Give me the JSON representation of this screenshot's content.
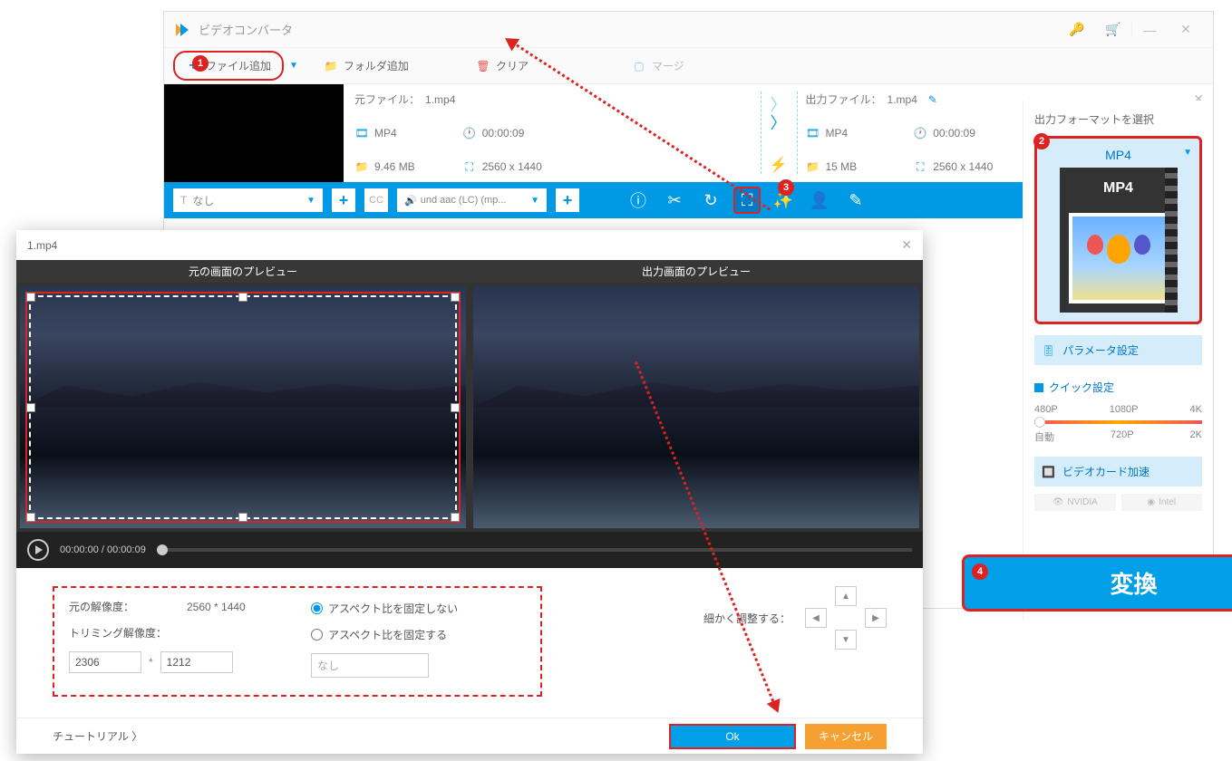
{
  "app": {
    "title": "ビデオコンバータ"
  },
  "toolbar": {
    "add_file": "ファイル追加",
    "add_folder": "フォルダ追加",
    "clear": "クリア",
    "merge": "マージ"
  },
  "source_file": {
    "label": "元ファイル：",
    "name": "1.mp4",
    "format": "MP4",
    "duration": "00:00:09",
    "size": "9.46 MB",
    "resolution": "2560 x 1440"
  },
  "output_file": {
    "label": "出力ファイル：",
    "name": "1.mp4",
    "format": "MP4",
    "duration": "00:00:09",
    "size": "15 MB",
    "resolution": "2560 x 1440"
  },
  "edit_toolbar": {
    "subtitle": "なし",
    "audio": "und aac (LC) (mp..."
  },
  "right_panel": {
    "title": "出力フォーマットを選択",
    "format_label": "MP4",
    "param_settings": "パラメータ設定",
    "quick_settings": "クイック設定",
    "presets_top": [
      "480P",
      "1080P",
      "4K"
    ],
    "presets_bottom": [
      "自動",
      "720P",
      "2K"
    ],
    "video_card": "ビデオカード加速",
    "nvidia": "NVIDIA",
    "intel": "Intel"
  },
  "convert": {
    "label": "変換"
  },
  "dialog": {
    "title": "1.mp4",
    "preview_src": "元の画面のプレビュー",
    "preview_out": "出力画面のプレビュー",
    "time_current": "00:00:00",
    "time_total": "00:00:09",
    "src_res_label": "元の解像度：",
    "src_res_value": "2560 * 1440",
    "trim_res_label": "トリミング解像度：",
    "trim_w": "2306",
    "trim_h": "1212",
    "aspect_unlock": "アスペクト比を固定しない",
    "aspect_lock": "アスペクト比を固定する",
    "aspect_combo": "なし",
    "fine_adjust_label": "細かく調整する：",
    "tutorial": "チュートリアル 〉",
    "ok": "Ok",
    "cancel": "キャンセル"
  }
}
